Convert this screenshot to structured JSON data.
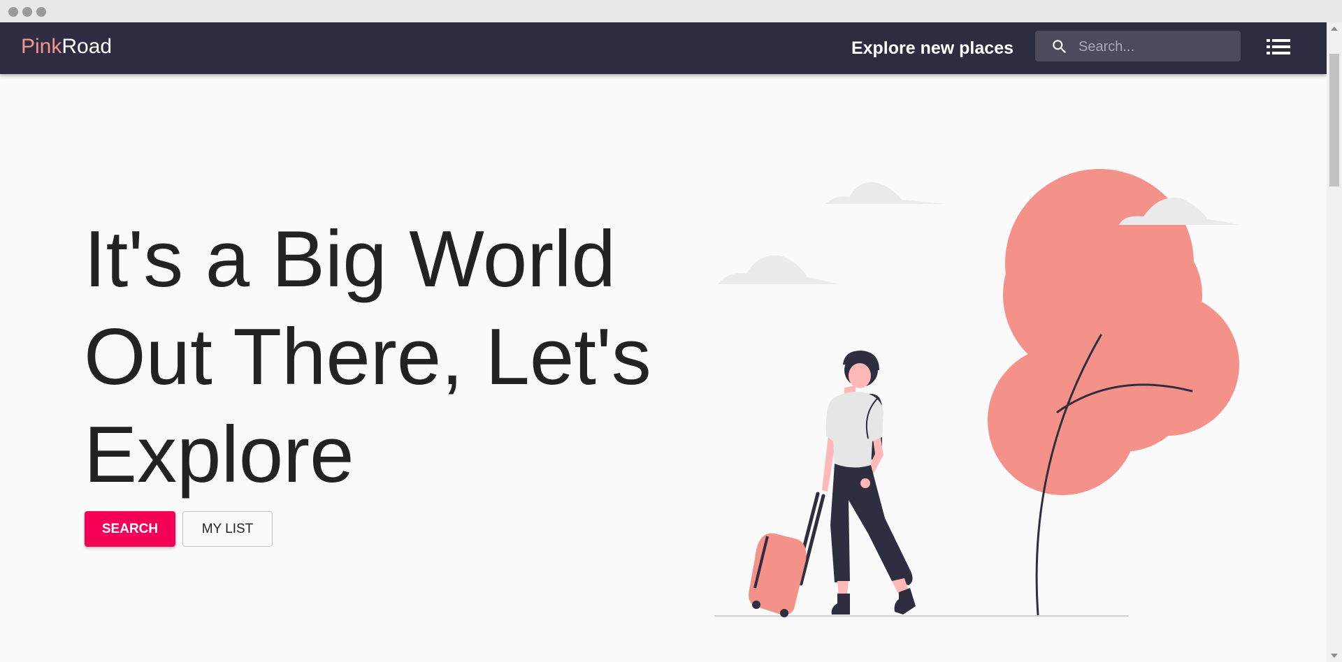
{
  "brand": {
    "part1": "Pink",
    "part2": "Road"
  },
  "nav": {
    "explore_label": "Explore new places"
  },
  "search": {
    "placeholder": "Search...",
    "value": "",
    "icon": "search-icon"
  },
  "menu": {
    "icon": "list-icon"
  },
  "hero": {
    "line1": "It's a Big World",
    "line2": "Out There, Let's",
    "line3": "Explore"
  },
  "buttons": {
    "search_label": "SEARCH",
    "mylist_label": "MY LIST"
  },
  "colors": {
    "appbar": "#2e2c41",
    "brand_accent": "#f4958d",
    "primary_button": "#f50057",
    "illustration_accent": "#f4928a",
    "illustration_dark": "#2f2e41"
  }
}
